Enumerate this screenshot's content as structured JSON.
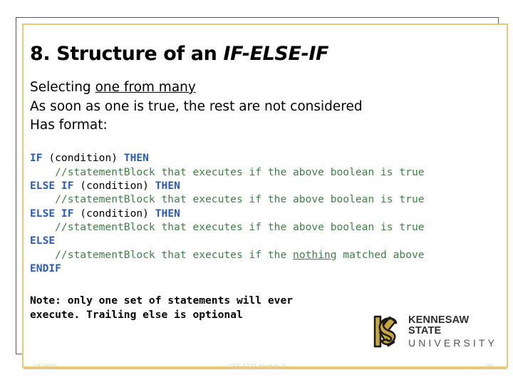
{
  "slide": {
    "title_prefix": "8. Structure of an ",
    "title_italic": "IF-ELSE-IF",
    "bullets": [
      {
        "pre": "Selecting ",
        "underline": "one from many",
        "post": ""
      },
      {
        "pre": "As soon as one is true, the rest are not considered",
        "underline": "",
        "post": ""
      },
      {
        "pre": "Has format:",
        "underline": "",
        "post": ""
      }
    ],
    "code_lines": [
      [
        {
          "text": "IF",
          "style": "kw"
        },
        {
          "text": " (condition) ",
          "style": "pl"
        },
        {
          "text": "THEN",
          "style": "kw"
        }
      ],
      [
        {
          "text": "    //statementBlock that executes if the above boolean is true",
          "style": "cmt"
        }
      ],
      [
        {
          "text": "ELSE IF",
          "style": "kw"
        },
        {
          "text": " (condition) ",
          "style": "pl"
        },
        {
          "text": "THEN",
          "style": "kw"
        }
      ],
      [
        {
          "text": "    //statementBlock that executes if the above boolean is true",
          "style": "cmt"
        }
      ],
      [
        {
          "text": "ELSE IF",
          "style": "kw"
        },
        {
          "text": " (condition) ",
          "style": "pl"
        },
        {
          "text": "THEN",
          "style": "kw"
        }
      ],
      [
        {
          "text": "    //statementBlock that executes if the above boolean is true",
          "style": "cmt"
        }
      ],
      [
        {
          "text": "ELSE",
          "style": "kw"
        }
      ],
      [
        {
          "text": "    //statementBlock that executes if the ",
          "style": "cmt"
        },
        {
          "text": "nothing",
          "style": "cmt-u"
        },
        {
          "text": " matched above",
          "style": "cmt"
        }
      ],
      [
        {
          "text": "ENDIF",
          "style": "kw"
        }
      ]
    ],
    "note": "Note: only one set of statements will ever\nexecute. Trailing else is optional"
  },
  "logo": {
    "name": "kennesaw-state-university-logo",
    "line1": "KENNESAW STATE",
    "line2": "UNIVERSITY",
    "gold": "#C7A63C",
    "dark": "#1A1A1A"
  },
  "footer": {
    "date": "3/5/2021",
    "title": "CSE 1321 Module 3",
    "page": "35"
  },
  "colors": {
    "keyword_blue": "#2b5bb5",
    "comment_green": "#3e8048",
    "frame_gold": "#e8c877",
    "frame_gray": "#585858"
  }
}
